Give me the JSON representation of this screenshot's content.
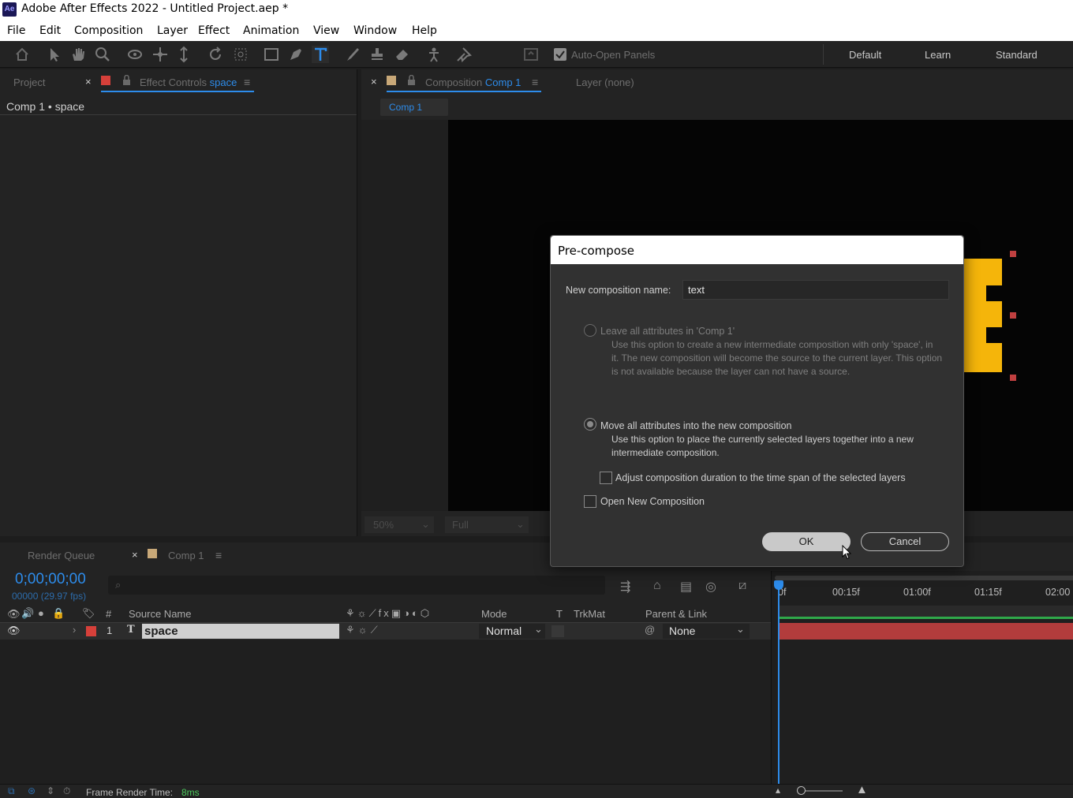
{
  "window": {
    "logo": "Ae",
    "title": "Adobe After Effects 2022 - Untitled Project.aep *"
  },
  "menu": [
    "File",
    "Edit",
    "Composition",
    "Layer",
    "Effect",
    "Animation",
    "View",
    "Window",
    "Help"
  ],
  "toolbar": {
    "auto_open_label": "Auto-Open Panels",
    "workspaces": [
      "Default",
      "Learn",
      "Standard"
    ]
  },
  "left_panel": {
    "tab_project": "Project",
    "tab_effect_controls": "Effect Controls",
    "tab_effect_layer": "space",
    "breadcrumb": "Comp 1 • space"
  },
  "comp_panel": {
    "tab_composition": "Composition",
    "tab_comp_name": "Comp 1",
    "tab_layer": "Layer (none)",
    "subtab": "Comp 1",
    "zoom": "50%",
    "resolution": "Full"
  },
  "dialog": {
    "title": "Pre-compose",
    "name_label": "New composition name:",
    "name_value": "text",
    "option1_label": "Leave all attributes in 'Comp 1'",
    "option1_desc": "Use this option to create a new intermediate composition with only 'space', in it. The new composition will become the source to the current layer. This option is not available because the layer can not have a source.",
    "option2_label": "Move all attributes into the new composition",
    "option2_desc": "Use this option to place the currently selected layers together into a new intermediate composition.",
    "adjust_label": "Adjust composition duration to the time span of the selected layers",
    "open_new_label": "Open New Composition",
    "ok_label": "OK",
    "cancel_label": "Cancel",
    "selected_option": "move"
  },
  "timeline": {
    "tab_render_queue": "Render Queue",
    "tab_comp": "Comp 1",
    "timecode": "0;00;00;00",
    "frame_info": "00000 (29.97 fps)",
    "headers": {
      "hash": "#",
      "source_name": "Source Name",
      "mode": "Mode",
      "t": "T",
      "trkmat": "TrkMat",
      "parent": "Parent & Link"
    },
    "ruler": [
      "0f",
      "00:15f",
      "01:00f",
      "01:15f",
      "02:00"
    ],
    "layer": {
      "index": "1",
      "type": "T",
      "name": "space",
      "mode": "Normal",
      "parent": "None"
    }
  },
  "status": {
    "render_label": "Frame Render Time:",
    "render_value": "8ms"
  },
  "colors": {
    "accent_blue": "#2d8ceb",
    "layer_label_red": "#d6403a",
    "text_yellow": "#f5b50a",
    "layer_bar": "#b23c3c"
  }
}
